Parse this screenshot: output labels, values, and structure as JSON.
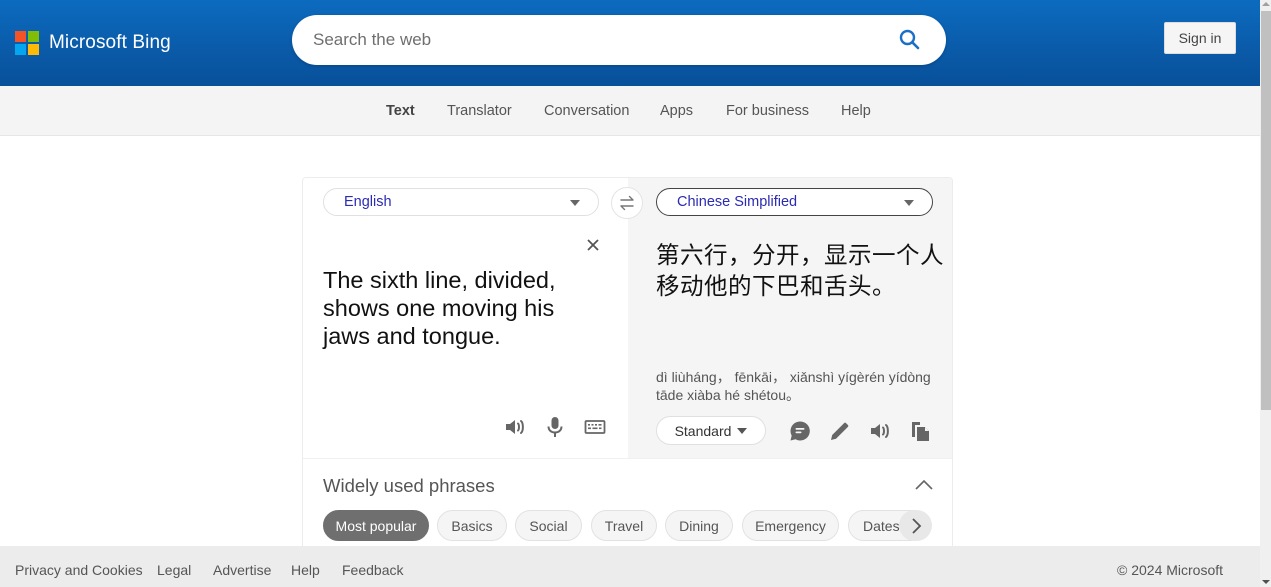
{
  "header": {
    "brand": "Microsoft Bing",
    "logo_colors": [
      "#f35325",
      "#81bc06",
      "#05a6f0",
      "#ffba08"
    ],
    "search_placeholder": "Search the web",
    "search_value": "",
    "search_icon": "search-icon",
    "sign_in_label": "Sign in"
  },
  "subnav": {
    "items": [
      {
        "label": "Text",
        "active": true
      },
      {
        "label": "Translator",
        "active": false
      },
      {
        "label": "Conversation",
        "active": false
      },
      {
        "label": "Apps",
        "active": false
      },
      {
        "label": "For business",
        "active": false
      },
      {
        "label": "Help",
        "active": false
      }
    ]
  },
  "translator": {
    "source_language": "English",
    "target_language": "Chinese Simplified",
    "swap_icon": "swap-arrows-icon",
    "clear_icon": "close-icon",
    "source_text": "The sixth line, divided, shows one moving his jaws and tongue.",
    "target_text": "第六行，分开，显示一个人移动他的下巴和舌头。",
    "transliteration": "dì liùháng， fēnkāi， xiǎnshì yígèrén yídòng tāde xiàba hé shétou。",
    "source_tools": [
      {
        "icon": "speaker-icon",
        "label": "Listen"
      },
      {
        "icon": "microphone-icon",
        "label": "Speak"
      },
      {
        "icon": "keyboard-icon",
        "label": "Keyboard"
      }
    ],
    "tone_label": "Standard",
    "target_tools": [
      {
        "icon": "chat-bubble-icon",
        "label": "Feedback"
      },
      {
        "icon": "pencil-icon",
        "label": "Edit"
      },
      {
        "icon": "speaker-icon",
        "label": "Listen"
      },
      {
        "icon": "copy-icon",
        "label": "Copy"
      }
    ]
  },
  "phrases": {
    "title": "Widely used phrases",
    "collapse_icon": "chevron-up-icon",
    "next_icon": "chevron-right-icon",
    "chips": [
      {
        "label": "Most popular",
        "active": true
      },
      {
        "label": "Basics",
        "active": false
      },
      {
        "label": "Social",
        "active": false
      },
      {
        "label": "Travel",
        "active": false
      },
      {
        "label": "Dining",
        "active": false
      },
      {
        "label": "Emergency",
        "active": false
      },
      {
        "label": "Dates",
        "active": false
      }
    ]
  },
  "footer": {
    "links": [
      "Privacy and Cookies",
      "Legal",
      "Advertise",
      "Help",
      "Feedback"
    ],
    "copyright": "© 2024 Microsoft"
  }
}
